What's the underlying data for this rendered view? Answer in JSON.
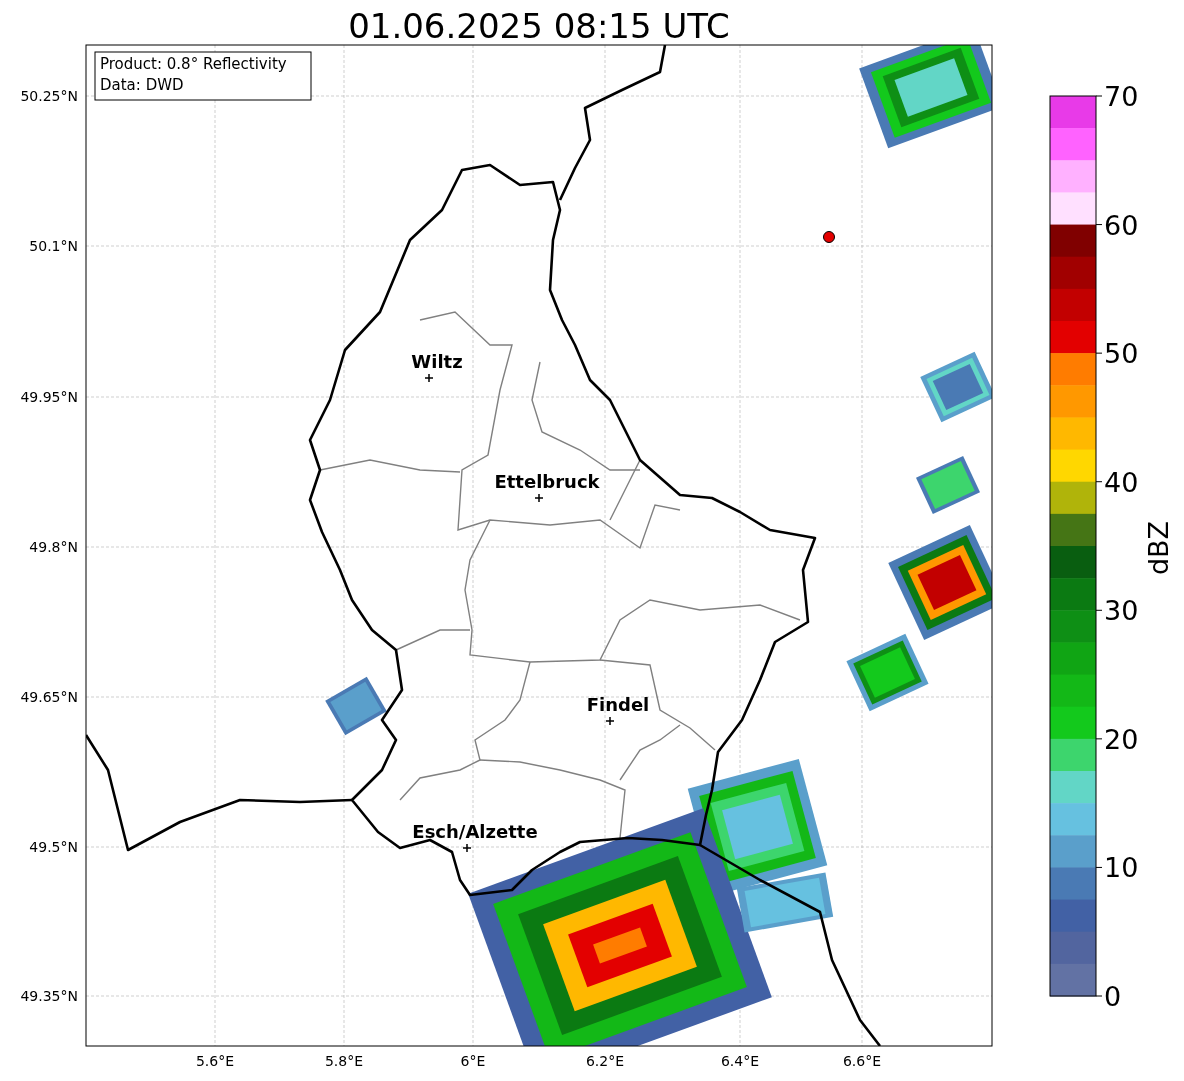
{
  "title": "01.06.2025 08:15 UTC",
  "info_box": {
    "lines": [
      "Product: 0.8° Reflectivity",
      "Data: DWD"
    ]
  },
  "cities": [
    {
      "name": "Wiltz"
    },
    {
      "name": "Ettelbruck"
    },
    {
      "name": "Findel"
    },
    {
      "name": "Esch/Alzette"
    }
  ],
  "lat_labels": [
    "50.25°N",
    "50.1°N",
    "49.95°N",
    "49.8°N",
    "49.65°N",
    "49.5°N",
    "49.35°N"
  ],
  "lon_labels": [
    "5.6°E",
    "5.8°E",
    "6°E",
    "6.2°E",
    "6.4°E",
    "6.6°E"
  ],
  "colorbar": {
    "label": "dBZ",
    "ticks": [
      "70",
      "60",
      "50",
      "40",
      "30",
      "20",
      "10",
      "0"
    ],
    "bands": [
      {
        "color": "#e83ae8"
      },
      {
        "color": "#ff62ff"
      },
      {
        "color": "#ffb1ff"
      },
      {
        "color": "#ffe0ff"
      },
      {
        "color": "#800000"
      },
      {
        "color": "#a10000"
      },
      {
        "color": "#c20000"
      },
      {
        "color": "#e30000"
      },
      {
        "color": "#ff7c00"
      },
      {
        "color": "#ff9800"
      },
      {
        "color": "#ffb800"
      },
      {
        "color": "#ffd700"
      },
      {
        "color": "#b0b40a"
      },
      {
        "color": "#457515"
      },
      {
        "color": "#095e10"
      },
      {
        "color": "#0b7a12"
      },
      {
        "color": "#0e8f15"
      },
      {
        "color": "#10a514"
      },
      {
        "color": "#13b817"
      },
      {
        "color": "#13c91c"
      },
      {
        "color": "#3dd56d"
      },
      {
        "color": "#62d6c6"
      },
      {
        "color": "#66c1e0"
      },
      {
        "color": "#5a9fcb"
      },
      {
        "color": "#4a7ab4"
      },
      {
        "color": "#4261a5"
      },
      {
        "color": "#52659f"
      },
      {
        "color": "#6272a4"
      }
    ]
  }
}
